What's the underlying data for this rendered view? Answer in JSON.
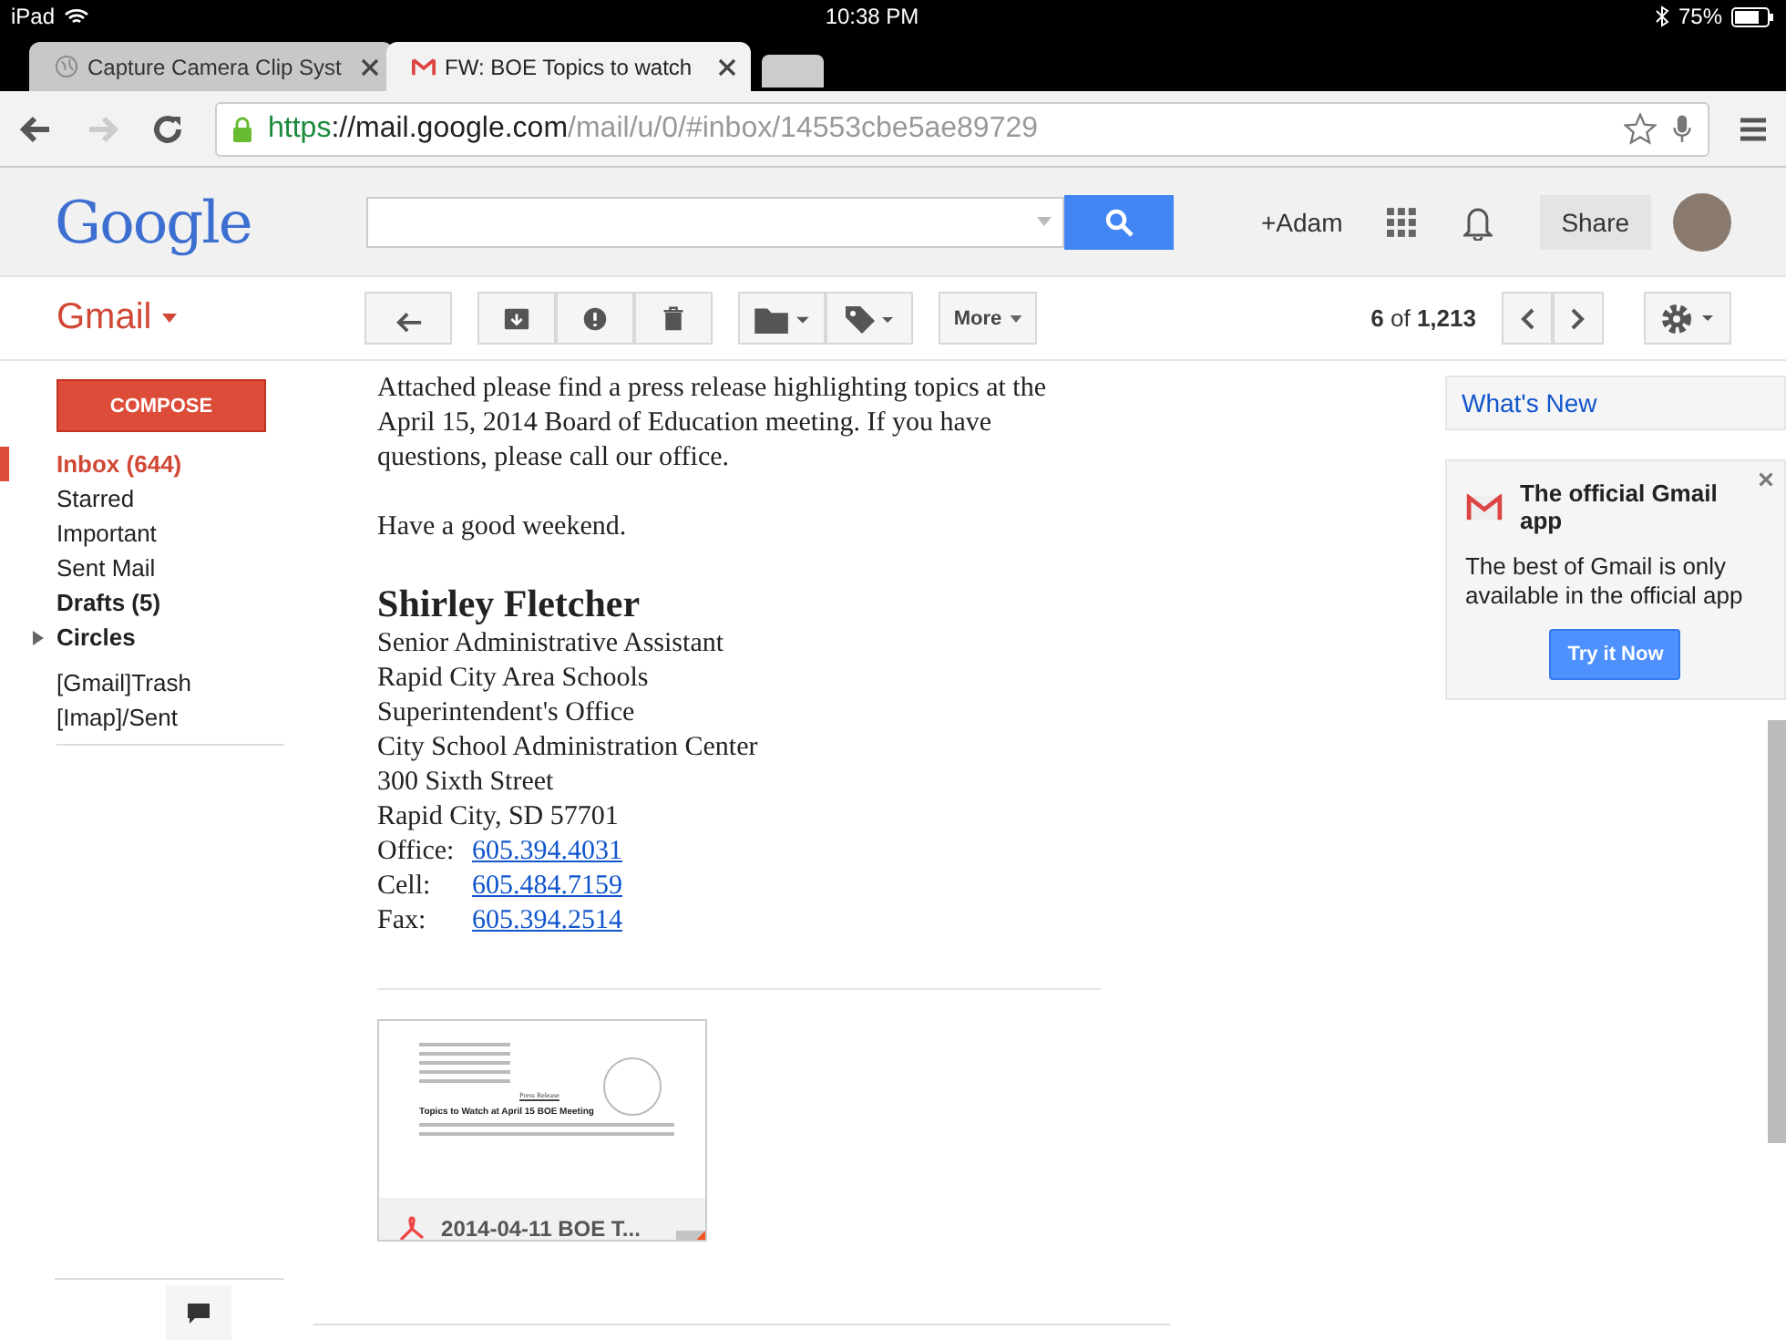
{
  "status_bar": {
    "carrier": "iPad",
    "time": "10:38 PM",
    "battery": "75%"
  },
  "tabs": [
    {
      "title": "Capture Camera Clip Syst",
      "kind": "globe",
      "selected": false
    },
    {
      "title": "FW: BOE Topics to watch",
      "kind": "gmail",
      "selected": true
    }
  ],
  "address_bar": {
    "scheme": "https",
    "host": "://mail.google.com",
    "path": "/mail/u/0/#inbox/14553cbe5ae89729"
  },
  "header": {
    "logo": "Google",
    "user": "+Adam",
    "share": "Share"
  },
  "gmail_bar": {
    "label": "Gmail",
    "more": "More",
    "pager": "**6** of **1,213**"
  },
  "sidebar": {
    "compose": "COMPOSE",
    "items": [
      {
        "label": "Inbox (644)",
        "selected": true,
        "bold": true
      },
      {
        "label": "Starred",
        "selected": false,
        "bold": false
      },
      {
        "label": "Important",
        "selected": false,
        "bold": false
      },
      {
        "label": "Sent Mail",
        "selected": false,
        "bold": false
      },
      {
        "label": "Drafts (5)",
        "selected": false,
        "bold": true
      },
      {
        "label": "Circles",
        "selected": false,
        "bold": true,
        "expanded": false
      },
      {
        "label": "[Gmail]Trash",
        "selected": false,
        "bold": false
      },
      {
        "label": "[Imap]/Sent",
        "selected": false,
        "bold": false
      }
    ]
  },
  "email": {
    "paragraphs": [
      "Attached please find a press release highlighting topics at the April 15, 2014 Board of Education meeting. If you have questions, please call our office.",
      "Have a good weekend."
    ],
    "signature": {
      "name": "Shirley Fletcher",
      "lines": [
        "Senior Administrative Assistant",
        "Rapid City Area Schools",
        "Superintendent's Office",
        "City School Administration Center",
        "300 Sixth Street",
        "Rapid City, SD  57701"
      ],
      "contacts": [
        {
          "label": "Office:",
          "number": "605.394.4031"
        },
        {
          "label": "Cell:",
          "number": "605.484.7159"
        },
        {
          "label": "Fax:",
          "number": "605.394.2514"
        }
      ]
    },
    "attachment": {
      "heading": "Press Release",
      "title": "Topics to Watch at April 15 BOE Meeting",
      "name": "2014-04-11 BOE T..."
    }
  },
  "right_panel": {
    "whats_new": "What's New",
    "promo": {
      "title": "The official Gmail app",
      "text": "The best of Gmail is only available in the official app",
      "button": "Try it Now"
    }
  }
}
